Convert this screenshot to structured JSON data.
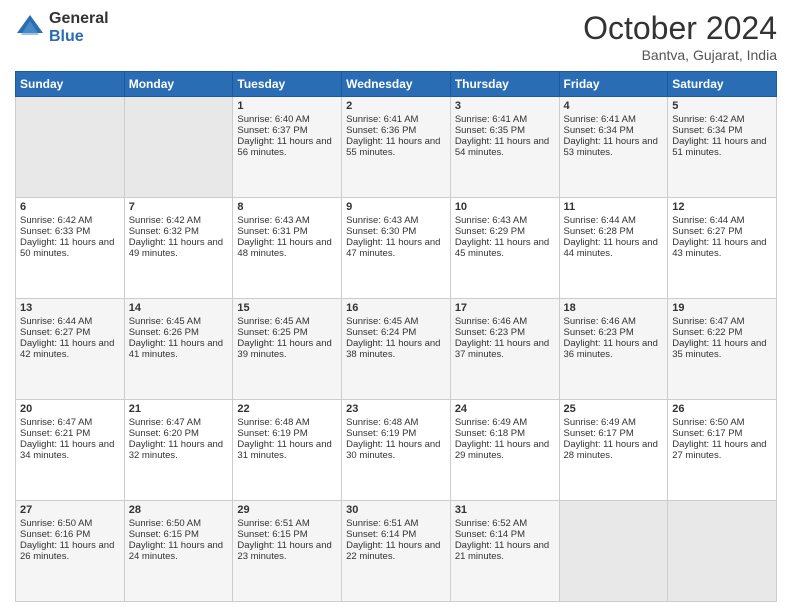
{
  "header": {
    "logo_general": "General",
    "logo_blue": "Blue",
    "month_title": "October 2024",
    "location": "Bantva, Gujarat, India"
  },
  "days_of_week": [
    "Sunday",
    "Monday",
    "Tuesday",
    "Wednesday",
    "Thursday",
    "Friday",
    "Saturday"
  ],
  "weeks": [
    [
      {
        "day": "",
        "sunrise": "",
        "sunset": "",
        "daylight": "",
        "empty": true
      },
      {
        "day": "",
        "sunrise": "",
        "sunset": "",
        "daylight": "",
        "empty": true
      },
      {
        "day": "1",
        "sunrise": "Sunrise: 6:40 AM",
        "sunset": "Sunset: 6:37 PM",
        "daylight": "Daylight: 11 hours and 56 minutes.",
        "empty": false
      },
      {
        "day": "2",
        "sunrise": "Sunrise: 6:41 AM",
        "sunset": "Sunset: 6:36 PM",
        "daylight": "Daylight: 11 hours and 55 minutes.",
        "empty": false
      },
      {
        "day": "3",
        "sunrise": "Sunrise: 6:41 AM",
        "sunset": "Sunset: 6:35 PM",
        "daylight": "Daylight: 11 hours and 54 minutes.",
        "empty": false
      },
      {
        "day": "4",
        "sunrise": "Sunrise: 6:41 AM",
        "sunset": "Sunset: 6:34 PM",
        "daylight": "Daylight: 11 hours and 53 minutes.",
        "empty": false
      },
      {
        "day": "5",
        "sunrise": "Sunrise: 6:42 AM",
        "sunset": "Sunset: 6:34 PM",
        "daylight": "Daylight: 11 hours and 51 minutes.",
        "empty": false
      }
    ],
    [
      {
        "day": "6",
        "sunrise": "Sunrise: 6:42 AM",
        "sunset": "Sunset: 6:33 PM",
        "daylight": "Daylight: 11 hours and 50 minutes.",
        "empty": false
      },
      {
        "day": "7",
        "sunrise": "Sunrise: 6:42 AM",
        "sunset": "Sunset: 6:32 PM",
        "daylight": "Daylight: 11 hours and 49 minutes.",
        "empty": false
      },
      {
        "day": "8",
        "sunrise": "Sunrise: 6:43 AM",
        "sunset": "Sunset: 6:31 PM",
        "daylight": "Daylight: 11 hours and 48 minutes.",
        "empty": false
      },
      {
        "day": "9",
        "sunrise": "Sunrise: 6:43 AM",
        "sunset": "Sunset: 6:30 PM",
        "daylight": "Daylight: 11 hours and 47 minutes.",
        "empty": false
      },
      {
        "day": "10",
        "sunrise": "Sunrise: 6:43 AM",
        "sunset": "Sunset: 6:29 PM",
        "daylight": "Daylight: 11 hours and 45 minutes.",
        "empty": false
      },
      {
        "day": "11",
        "sunrise": "Sunrise: 6:44 AM",
        "sunset": "Sunset: 6:28 PM",
        "daylight": "Daylight: 11 hours and 44 minutes.",
        "empty": false
      },
      {
        "day": "12",
        "sunrise": "Sunrise: 6:44 AM",
        "sunset": "Sunset: 6:27 PM",
        "daylight": "Daylight: 11 hours and 43 minutes.",
        "empty": false
      }
    ],
    [
      {
        "day": "13",
        "sunrise": "Sunrise: 6:44 AM",
        "sunset": "Sunset: 6:27 PM",
        "daylight": "Daylight: 11 hours and 42 minutes.",
        "empty": false
      },
      {
        "day": "14",
        "sunrise": "Sunrise: 6:45 AM",
        "sunset": "Sunset: 6:26 PM",
        "daylight": "Daylight: 11 hours and 41 minutes.",
        "empty": false
      },
      {
        "day": "15",
        "sunrise": "Sunrise: 6:45 AM",
        "sunset": "Sunset: 6:25 PM",
        "daylight": "Daylight: 11 hours and 39 minutes.",
        "empty": false
      },
      {
        "day": "16",
        "sunrise": "Sunrise: 6:45 AM",
        "sunset": "Sunset: 6:24 PM",
        "daylight": "Daylight: 11 hours and 38 minutes.",
        "empty": false
      },
      {
        "day": "17",
        "sunrise": "Sunrise: 6:46 AM",
        "sunset": "Sunset: 6:23 PM",
        "daylight": "Daylight: 11 hours and 37 minutes.",
        "empty": false
      },
      {
        "day": "18",
        "sunrise": "Sunrise: 6:46 AM",
        "sunset": "Sunset: 6:23 PM",
        "daylight": "Daylight: 11 hours and 36 minutes.",
        "empty": false
      },
      {
        "day": "19",
        "sunrise": "Sunrise: 6:47 AM",
        "sunset": "Sunset: 6:22 PM",
        "daylight": "Daylight: 11 hours and 35 minutes.",
        "empty": false
      }
    ],
    [
      {
        "day": "20",
        "sunrise": "Sunrise: 6:47 AM",
        "sunset": "Sunset: 6:21 PM",
        "daylight": "Daylight: 11 hours and 34 minutes.",
        "empty": false
      },
      {
        "day": "21",
        "sunrise": "Sunrise: 6:47 AM",
        "sunset": "Sunset: 6:20 PM",
        "daylight": "Daylight: 11 hours and 32 minutes.",
        "empty": false
      },
      {
        "day": "22",
        "sunrise": "Sunrise: 6:48 AM",
        "sunset": "Sunset: 6:19 PM",
        "daylight": "Daylight: 11 hours and 31 minutes.",
        "empty": false
      },
      {
        "day": "23",
        "sunrise": "Sunrise: 6:48 AM",
        "sunset": "Sunset: 6:19 PM",
        "daylight": "Daylight: 11 hours and 30 minutes.",
        "empty": false
      },
      {
        "day": "24",
        "sunrise": "Sunrise: 6:49 AM",
        "sunset": "Sunset: 6:18 PM",
        "daylight": "Daylight: 11 hours and 29 minutes.",
        "empty": false
      },
      {
        "day": "25",
        "sunrise": "Sunrise: 6:49 AM",
        "sunset": "Sunset: 6:17 PM",
        "daylight": "Daylight: 11 hours and 28 minutes.",
        "empty": false
      },
      {
        "day": "26",
        "sunrise": "Sunrise: 6:50 AM",
        "sunset": "Sunset: 6:17 PM",
        "daylight": "Daylight: 11 hours and 27 minutes.",
        "empty": false
      }
    ],
    [
      {
        "day": "27",
        "sunrise": "Sunrise: 6:50 AM",
        "sunset": "Sunset: 6:16 PM",
        "daylight": "Daylight: 11 hours and 26 minutes.",
        "empty": false
      },
      {
        "day": "28",
        "sunrise": "Sunrise: 6:50 AM",
        "sunset": "Sunset: 6:15 PM",
        "daylight": "Daylight: 11 hours and 24 minutes.",
        "empty": false
      },
      {
        "day": "29",
        "sunrise": "Sunrise: 6:51 AM",
        "sunset": "Sunset: 6:15 PM",
        "daylight": "Daylight: 11 hours and 23 minutes.",
        "empty": false
      },
      {
        "day": "30",
        "sunrise": "Sunrise: 6:51 AM",
        "sunset": "Sunset: 6:14 PM",
        "daylight": "Daylight: 11 hours and 22 minutes.",
        "empty": false
      },
      {
        "day": "31",
        "sunrise": "Sunrise: 6:52 AM",
        "sunset": "Sunset: 6:14 PM",
        "daylight": "Daylight: 11 hours and 21 minutes.",
        "empty": false
      },
      {
        "day": "",
        "sunrise": "",
        "sunset": "",
        "daylight": "",
        "empty": true
      },
      {
        "day": "",
        "sunrise": "",
        "sunset": "",
        "daylight": "",
        "empty": true
      }
    ]
  ]
}
